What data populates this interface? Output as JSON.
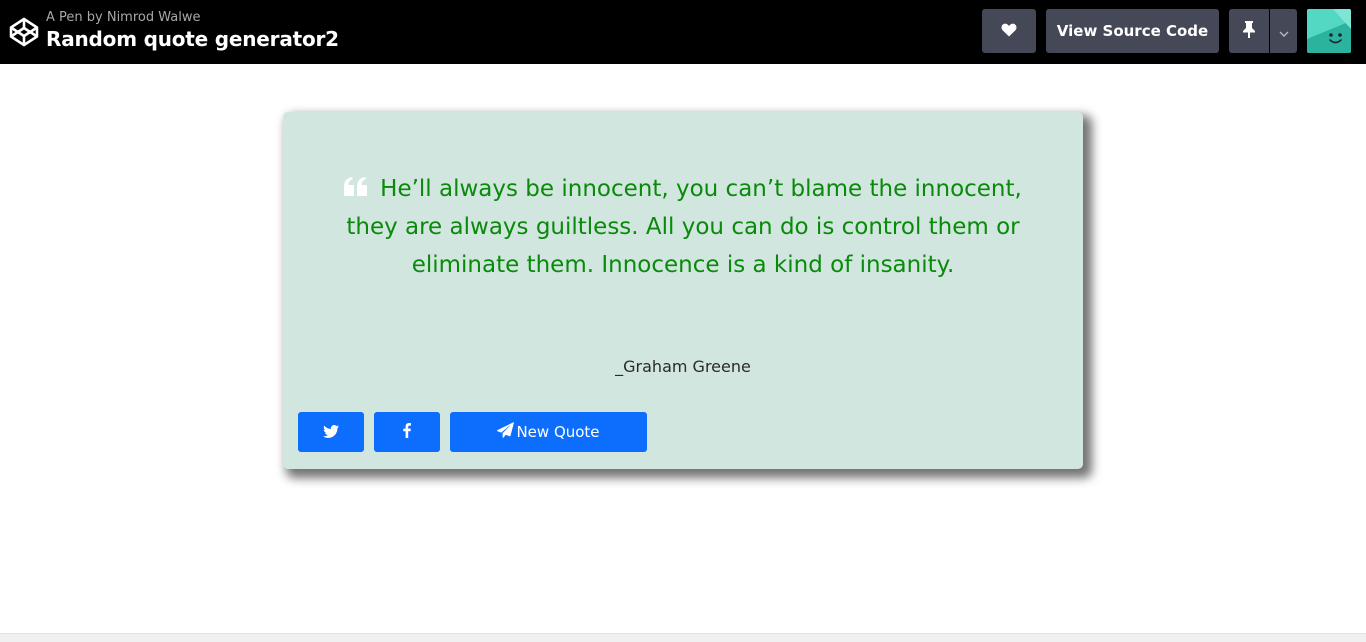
{
  "header": {
    "pen_by": "A Pen by Nimrod Walwe",
    "title": "Random quote generator2",
    "view_source_label": "View Source Code",
    "icons": {
      "logo": "codepen-logo-icon",
      "heart": "heart-icon",
      "pin": "pin-icon",
      "dropdown": "chevron-down-icon"
    }
  },
  "quote": {
    "text": "He’ll always be innocent, you can’t blame the innocent, they are always guiltless. All you can do is control them or eliminate them. Innocence is a kind of insanity.",
    "author": "_Graham Greene",
    "icon": "quote-left-icon"
  },
  "actions": {
    "new_quote_label": "New Quote",
    "icons": {
      "twitter": "twitter-icon",
      "facebook": "facebook-icon",
      "send": "paper-plane-icon"
    }
  },
  "colors": {
    "topbar_bg": "#000000",
    "button_bg": "#444857",
    "card_bg": "#d1e6df",
    "quote_text": "#0a8a0a",
    "primary_button": "#0d6efd"
  }
}
